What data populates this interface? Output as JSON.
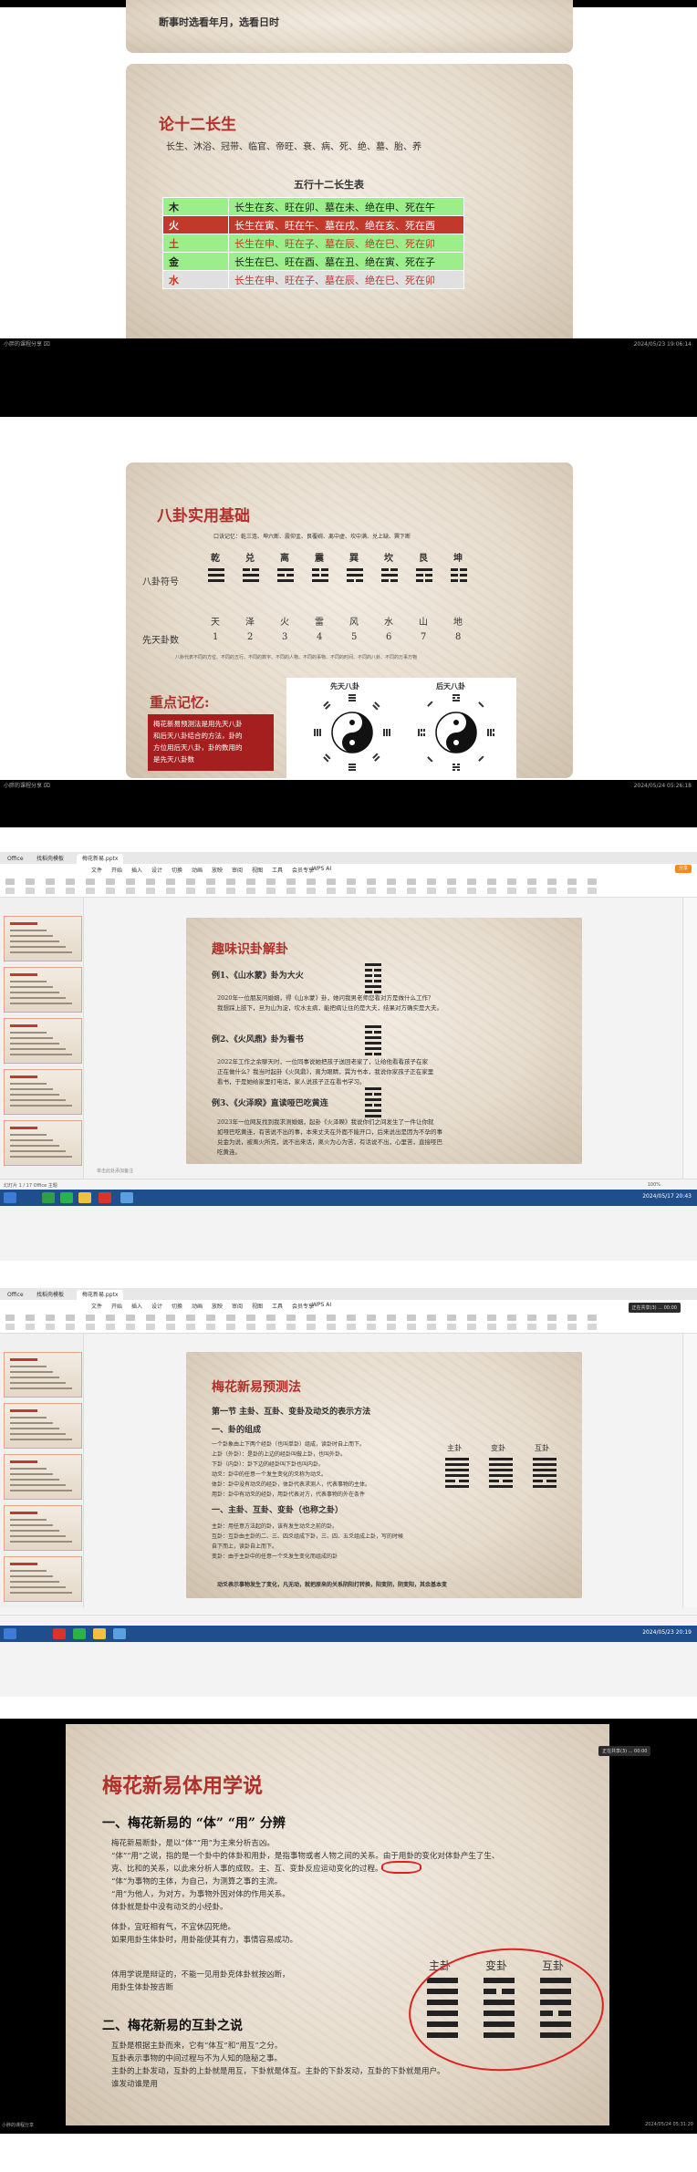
{
  "frame1": {
    "top_text": "断事时选看年月，选看日时",
    "title": "论十二长生",
    "stages": "长生、沐浴、冠带、临官、帝旺、衰、病、死、绝、墓、胎、养",
    "table_title": "五行十二长生表",
    "rows": [
      {
        "el": "木",
        "text": "长生在亥、旺在卯、墓在未、绝在申、死在午",
        "bg": "#9cee8a",
        "fg": "#222222"
      },
      {
        "el": "火",
        "text": "长生在寅、旺在午、墓在戌、绝在亥、死在酉",
        "bg": "#c0392b",
        "fg": "#ffffff"
      },
      {
        "el": "土",
        "text": "长生在申、旺在子、墓在辰、绝在巳、死在卯",
        "bg": "#9cee8a",
        "fg": "#c0392b"
      },
      {
        "el": "金",
        "text": "长生在巳、旺在酉、墓在丑、绝在寅、死在子",
        "bg": "#9cee8a",
        "fg": "#222222"
      },
      {
        "el": "水",
        "text": "长生在申、旺在子、墓在辰、绝在巳、死在卯",
        "bg": "#e0e0e0",
        "fg": "#c0392b"
      }
    ],
    "status_left": "小胖的课程分享 ⌧",
    "status_right": "2024/05/23 19:06:14"
  },
  "frame2": {
    "title": "八卦实用基础",
    "mnemonic": "口诀记忆：乾三连、坤六断、震仰盂、艮覆碗、离中虚、坎中满、兑上缺、巽下断",
    "names": [
      "乾",
      "兑",
      "离",
      "震",
      "巽",
      "坎",
      "艮",
      "坤"
    ],
    "row_label_symbol": "八卦符号",
    "row_label_number": "先天卦数",
    "images": [
      "天",
      "泽",
      "火",
      "雷",
      "风",
      "水",
      "山",
      "地"
    ],
    "numbers": [
      "1",
      "2",
      "3",
      "4",
      "5",
      "6",
      "7",
      "8"
    ],
    "note": "八卦代表不同的方位、不同的五行、不同的数字、不同的人物、不同的事物、不同的时间、不同的八卦、不同的万事万物",
    "memory_title": "重点记忆:",
    "memory_box": [
      "梅花新易预测法是用先天八卦",
      "和后天八卦结合的方法，卦的",
      "方位用后天八卦，卦的数用的",
      "是先天八卦数"
    ],
    "diagram_labels": [
      "先天八卦",
      "后天八卦"
    ],
    "status_left": "小胖的课程分享 ⌧",
    "status_right": "2024/05/24 05:26:18"
  },
  "wps1": {
    "tabs": [
      "Office",
      "找稻壳模板",
      "梅花新易.pptx"
    ],
    "menu": [
      "文件",
      "开始",
      "插入",
      "设计",
      "切换",
      "动画",
      "放映",
      "审阅",
      "视图",
      "工具",
      "会员专享",
      "WPS AI"
    ],
    "share": "分享",
    "title": "趣味识卦解卦",
    "ex1_title": "例1、《山水蒙》卦为大火",
    "ex1_text": [
      "2020年一位朋友问婚姻，得《山水蒙》卦，她问我男老师您看对方是做什么工作？",
      "我想踩上肢下，旦为山为淀，坎水主病，能把病让住的是大夫，结果对方确实是大夫。"
    ],
    "ex2_title": "例2、《火风鼎》卦为看书",
    "ex2_text": [
      "2022年工作之余聊天时，一位同事说她把孩子送回老家了，让给他看看孩子在家",
      "正在做什么？我当时起卦《火风鼎》，离为眼睛，巽为书本，我说你家孩子正在家里",
      "看书，于是她给家里打电话，家人说孩子正在看书学习。"
    ],
    "ex3_title": "例3、《火泽睽》直读哑巴吃黄连",
    "ex3_text": [
      "2023年一位网友找到我求测婚姻，起卦《火泽睽》我说你们之间发生了一件让你就",
      "如哑巴吃黄连，有苦说不出的事，本来丈夫在外面不能开口，后来说出是因为不孕的事",
      "兑金为说，被离火所克，说不出来话，离火为心为苦，有话说不出，心里苦，直接哑巴",
      "吃黄连。"
    ],
    "note_bar": "单击此处添加备注",
    "status": "幻灯片 1 / 17  Office 主题",
    "zoom": "100%",
    "clock": "2024/05/17 20:43"
  },
  "wps2": {
    "tabs": [
      "Office",
      "找稻壳模板",
      "梅花新易.pptx"
    ],
    "title": "梅花新易预测法",
    "section": "第一节   主卦、互卦、变卦及动爻的表示方法",
    "h1": "一、卦的组成",
    "body1": [
      "一个卦象由上下两个经卦（也叫单卦）组成，读卦时自上而下。",
      "上卦（外卦）：是卦的上边的经卦叫做上卦，也叫外卦。",
      "下卦（内卦）：卦下边的经卦叫下卦也叫内卦。",
      "动爻：卦中的任意一个发生变化的爻称为动爻。",
      "体卦：卦中没有动爻的经卦，体卦代表求测人，代表事物的主体。",
      "用卦：卦中有动爻的经卦，用卦代表对方，代表事物的外在条件"
    ],
    "h2": "一、主卦、互卦、变卦（也称之卦）",
    "body2": [
      "主卦：用任意方法起的卦，该有发生动爻之前的卦。",
      "互卦：互卦由主卦的二、三、四爻组成下卦，三、四、五爻组成上卦，写的时候",
      "自下而上，读卦自上而下。",
      "变卦：由于主卦中的任意一个爻发生变化而组成的卦"
    ],
    "gua_labels": [
      "主卦",
      "变卦",
      "互卦"
    ],
    "footer": "动爻表示事物发生了变化，凡无动，就把原来的关系阴阳打转换，阳变阴，阴变阳，其余基本变",
    "popup": "正在共享(3) ... 00:00",
    "clock": "2024/05/23 20:19"
  },
  "frame5": {
    "title": "梅花新易体用学说",
    "h1": "一、梅花新易的 “体” “用” 分辨",
    "p1": [
      "梅花新易断卦，是以“体”“用”为主来分析吉凶。",
      "“体”“用”之说，指的是一个卦中的体卦和用卦，是指事物或者人物之间的关系。由于用卦的变化对体卦产生了生、",
      "克、比和的关系，以此来分析人事的成败。主、互、变卦反应运动变化的过程。",
      "“体”为事物的主体，为自己，为测算之事的主流。",
      "“用”为他人，为对方，为事物外因对体的作用关系。",
      "体卦就是卦中没有动爻的小经卦。"
    ],
    "p2": [
      "体卦，宜旺相有气，不宜休囚死绝。",
      "如果用卦生体卦时，用卦能使其有力，事情容易成功。"
    ],
    "p3": [
      "体用学说是辩证的，不能一见用卦克体卦就按凶断，",
      "用卦生体卦按吉断"
    ],
    "h2": "二、梅花新易的互卦之说",
    "p4": [
      "互卦是根据主卦而来，它有“体互”和“用互”之分。",
      "互卦表示事物的中间过程与不为人知的隐秘之事。",
      "主卦的上卦发动，互卦的上卦就是用互，下卦就是体互。主卦的下卦发动，互卦的下卦就是用户。",
      "谁发动谁是用"
    ],
    "gua_labels": [
      "主卦",
      "变卦",
      "互卦"
    ],
    "popup": "正在共享(3) ... 00:00",
    "watermark_left": "小胖的课程分享",
    "clock": "2024/05/24 05:31:20"
  },
  "colors": {
    "accent_red": "#c0392b",
    "taskbar": "#1f4e8c"
  }
}
